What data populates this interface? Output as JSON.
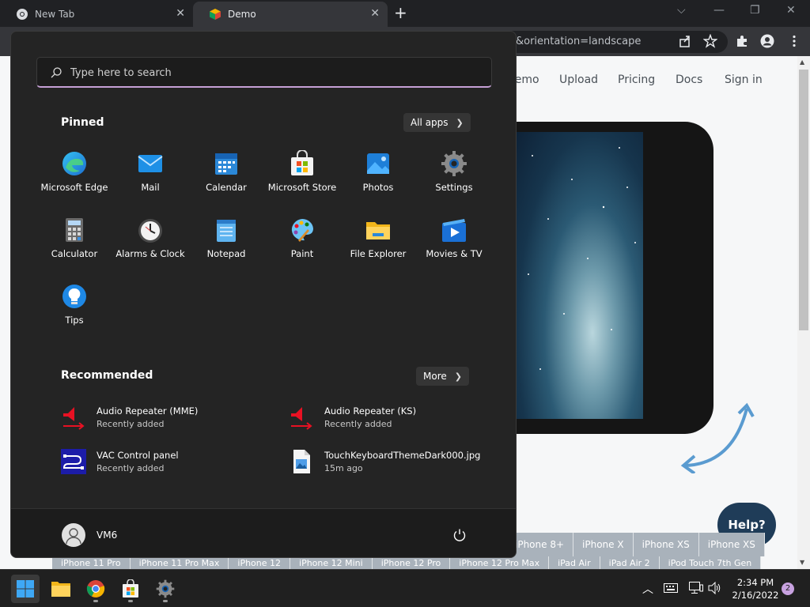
{
  "browser": {
    "tabs": [
      {
        "label": "New Tab"
      },
      {
        "label": "Demo"
      }
    ],
    "address_text": "&orientation=landscape"
  },
  "page": {
    "nav": [
      "Demo",
      "Upload",
      "Pricing",
      "Docs",
      "Sign in"
    ],
    "help_label": "Help?",
    "device_chips_row1": [
      "iPhone 8+",
      "iPhone X",
      "iPhone XS",
      "iPhone XS"
    ],
    "device_chips_row2": [
      "iPhone 11 Pro",
      "iPhone 11 Pro Max",
      "iPhone 12",
      "iPhone 12 Mini",
      "iPhone 12 Pro",
      "iPhone 12 Pro Max",
      "iPad Air",
      "iPad Air 2",
      "iPod Touch 7th Gen"
    ]
  },
  "start_menu": {
    "search_placeholder": "Type here to search",
    "pinned_title": "Pinned",
    "all_apps_label": "All apps",
    "pinned_apps": [
      {
        "label": "Microsoft Edge",
        "icon": "edge-icon"
      },
      {
        "label": "Mail",
        "icon": "mail-icon"
      },
      {
        "label": "Calendar",
        "icon": "calendar-icon"
      },
      {
        "label": "Microsoft Store",
        "icon": "store-icon"
      },
      {
        "label": "Photos",
        "icon": "photos-icon"
      },
      {
        "label": "Settings",
        "icon": "settings-gear-icon"
      },
      {
        "label": "Calculator",
        "icon": "calculator-icon"
      },
      {
        "label": "Alarms & Clock",
        "icon": "clock-icon"
      },
      {
        "label": "Notepad",
        "icon": "notepad-icon"
      },
      {
        "label": "Paint",
        "icon": "paint-palette-icon"
      },
      {
        "label": "File Explorer",
        "icon": "folder-icon"
      },
      {
        "label": "Movies & TV",
        "icon": "movies-play-icon"
      },
      {
        "label": "Tips",
        "icon": "lightbulb-icon"
      }
    ],
    "recommended_title": "Recommended",
    "more_label": "More",
    "recommended": [
      {
        "title": "Audio Repeater (MME)",
        "subtitle": "Recently added"
      },
      {
        "title": "Audio Repeater (KS)",
        "subtitle": "Recently added"
      },
      {
        "title": "VAC Control panel",
        "subtitle": "Recently added"
      },
      {
        "title": "TouchKeyboardThemeDark000.jpg",
        "subtitle": "15m ago"
      }
    ],
    "user_name": "VM6"
  },
  "taskbar": {
    "time": "2:34 PM",
    "date": "2/16/2022",
    "notification_count": "2"
  },
  "colors": {
    "start_bg": "#242424",
    "accent_underline": "#c6a0d6",
    "help_button": "#1f3c58"
  }
}
